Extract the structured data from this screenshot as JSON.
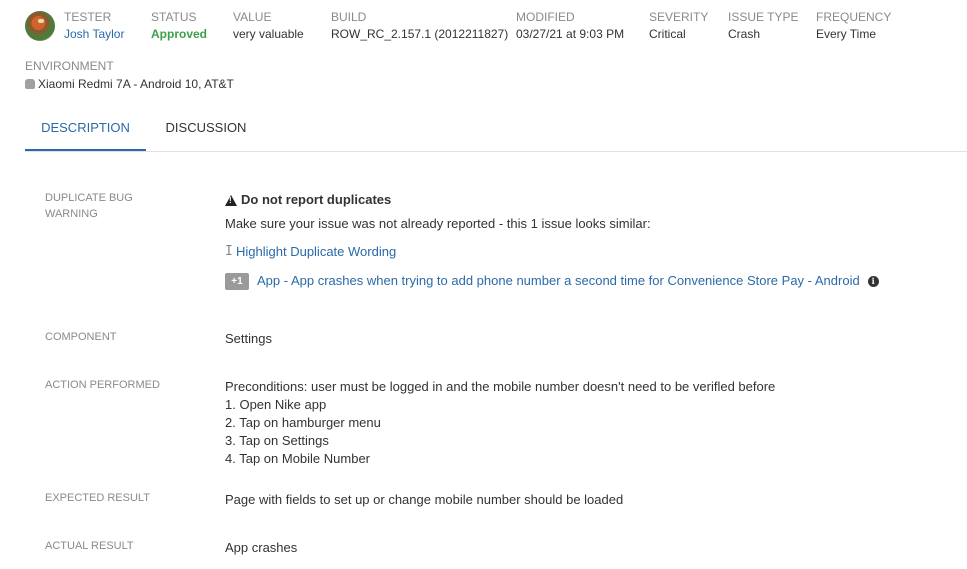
{
  "header": {
    "tester": {
      "label": "TESTER",
      "value": "Josh Taylor"
    },
    "status": {
      "label": "STATUS",
      "value": "Approved"
    },
    "value": {
      "label": "VALUE",
      "value": "very valuable"
    },
    "build": {
      "label": "BUILD",
      "value": "ROW_RC_2.157.1 (2012211827)"
    },
    "modified": {
      "label": "MODIFIED",
      "value": "03/27/21 at 9:03 PM"
    },
    "severity": {
      "label": "SEVERITY",
      "value": "Critical"
    },
    "issue_type": {
      "label": "ISSUE TYPE",
      "value": "Crash"
    },
    "frequency": {
      "label": "FREQUENCY",
      "value": "Every Time"
    }
  },
  "environment": {
    "label": "ENVIRONMENT",
    "value": "Xiaomi Redmi 7A - Android 10, AT&T",
    "icon": "android-icon"
  },
  "tabs": [
    {
      "label": "DESCRIPTION",
      "active": true
    },
    {
      "label": "DISCUSSION",
      "active": false
    }
  ],
  "fields": {
    "duplicate_warning": {
      "label": "DUPLICATE BUG WARNING",
      "title": "Do not report duplicates",
      "message": "Make sure your issue was not already reported - this 1 issue looks similar:",
      "highlight_link": "Highlight Duplicate Wording",
      "badge": "+1",
      "similar_issue": "App - App crashes when trying to add phone number a second time for Convenience Store Pay - Android"
    },
    "component": {
      "label": "COMPONENT",
      "value": "Settings"
    },
    "action_performed": {
      "label": "ACTION PERFORMED",
      "lines": [
        "Preconditions: user must be logged in and the mobile number doesn't need to be verifled before",
        "1. Open Nike app",
        "2. Tap on hamburger menu",
        "3. Tap on Settings",
        "4. Tap on Mobile Number"
      ]
    },
    "expected_result": {
      "label": "EXPECTED RESULT",
      "value": "Page with fields to set up or change mobile number should be loaded"
    },
    "actual_result": {
      "label": "ACTUAL RESULT",
      "value": "App crashes"
    }
  },
  "colors": {
    "link": "#2a6aa8",
    "approved": "#3aa048",
    "label": "#8a8a8a",
    "text": "#333333"
  }
}
